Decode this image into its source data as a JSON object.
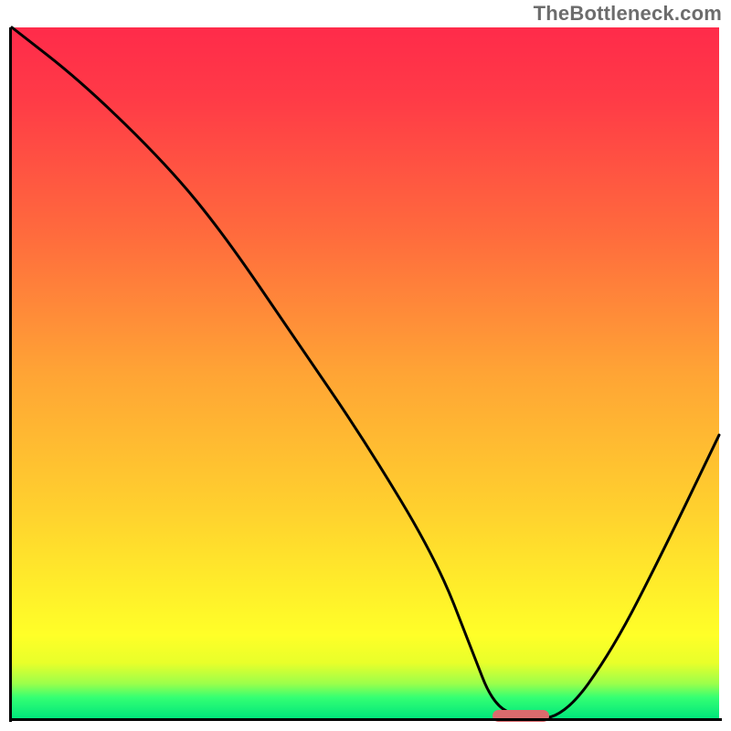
{
  "watermark": "TheBottleneck.com",
  "chart_data": {
    "type": "line",
    "title": "",
    "xlabel": "",
    "ylabel": "",
    "xlim": [
      0,
      100
    ],
    "ylim": [
      0,
      100
    ],
    "grid": false,
    "legend": false,
    "background_gradient": {
      "direction": "vertical",
      "stops": [
        {
          "y": 100,
          "color": "#ff2b4a"
        },
        {
          "y": 50,
          "color": "#ffa435"
        },
        {
          "y": 12,
          "color": "#ffff28"
        },
        {
          "y": 5,
          "color": "#9bff4b"
        },
        {
          "y": 0,
          "color": "#00e67b"
        }
      ]
    },
    "series": [
      {
        "name": "bottleneck-curve",
        "x": [
          0,
          10,
          22,
          30,
          40,
          50,
          60,
          65,
          68,
          72,
          78,
          85,
          92,
          100
        ],
        "y": [
          100,
          92,
          80,
          70,
          55,
          40,
          23,
          10,
          2,
          0,
          0,
          10,
          24,
          41
        ]
      }
    ],
    "annotations": [
      {
        "name": "optimal-zone-marker",
        "type": "segment",
        "y": 0,
        "x_start": 68,
        "x_end": 76,
        "color": "#db6b6d"
      }
    ]
  }
}
